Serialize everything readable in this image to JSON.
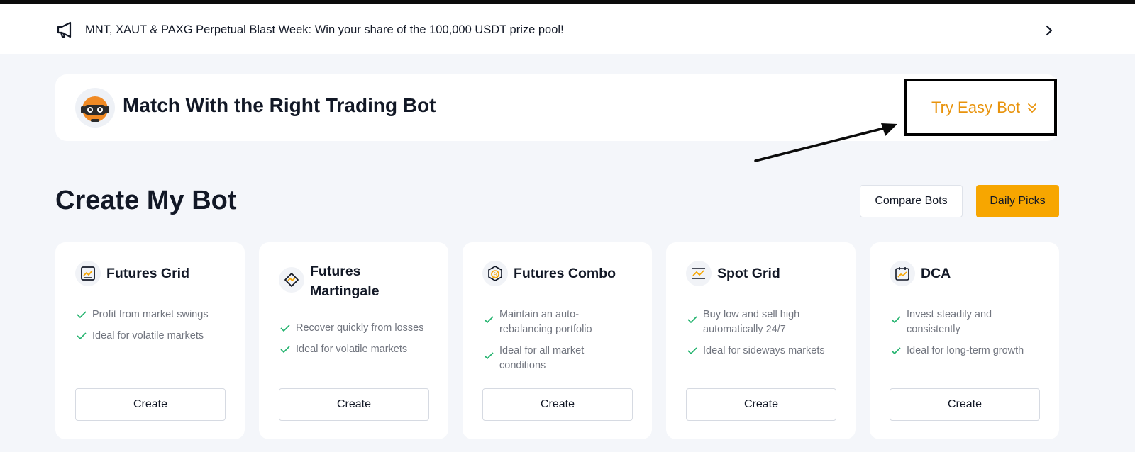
{
  "announcement": {
    "icon": "megaphone-icon",
    "text": "MNT, XAUT & PAXG Perpetual Blast Week: Win your share of the 100,000 USDT prize pool!"
  },
  "match": {
    "title": "Match With the Right Trading Bot",
    "try_label": "Try Easy Bot"
  },
  "section": {
    "title": "Create My Bot",
    "compare_label": "Compare Bots",
    "daily_label": "Daily Picks"
  },
  "colors": {
    "accent": "#f7a600",
    "accent_text": "#e8930c",
    "check": "#20b26c"
  },
  "cards": [
    {
      "title": "Futures Grid",
      "icon": "grid-chart-icon",
      "features": [
        "Profit from market swings",
        "Ideal for volatile markets"
      ],
      "create_label": "Create"
    },
    {
      "title": "Futures Martingale",
      "icon": "martingale-icon",
      "features": [
        "Recover quickly from losses",
        "Ideal for volatile markets"
      ],
      "create_label": "Create"
    },
    {
      "title": "Futures Combo",
      "icon": "combo-coin-icon",
      "features": [
        "Maintain an auto-rebalancing portfolio",
        "Ideal for all market conditions"
      ],
      "create_label": "Create"
    },
    {
      "title": "Spot Grid",
      "icon": "spot-grid-icon",
      "features": [
        "Buy low and sell high automatically 24/7",
        "Ideal for sideways markets"
      ],
      "create_label": "Create"
    },
    {
      "title": "DCA",
      "icon": "calendar-chart-icon",
      "features": [
        "Invest steadily and consistently",
        "Ideal for long-term growth"
      ],
      "create_label": "Create"
    }
  ]
}
